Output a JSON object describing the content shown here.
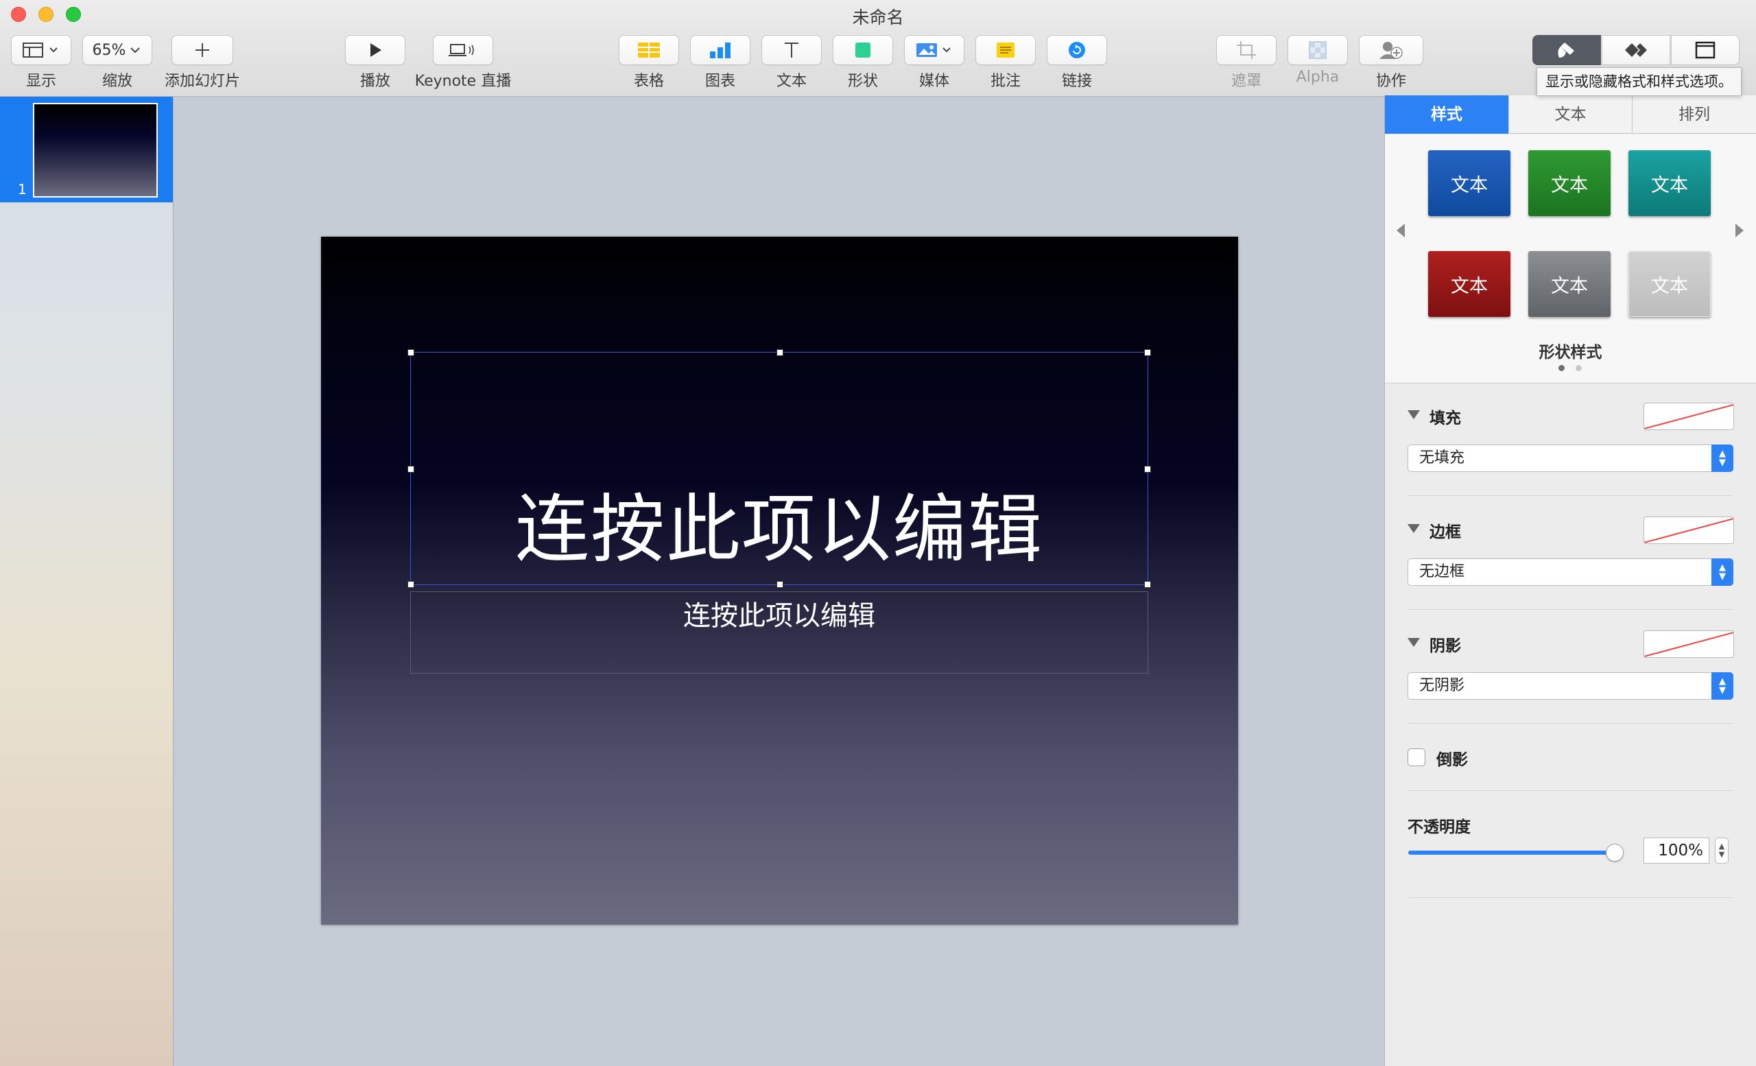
{
  "window": {
    "title": "未命名"
  },
  "toolbar": {
    "view_label": "显示",
    "zoom_value": "65%",
    "zoom_label": "缩放",
    "add_slide_label": "添加幻灯片",
    "play_label": "播放",
    "keynote_live_label": "Keynote 直播",
    "table_label": "表格",
    "chart_label": "图表",
    "text_label": "文本",
    "shape_label": "形状",
    "media_label": "媒体",
    "comment_label": "批注",
    "link_label": "链接",
    "mask_label": "遮罩",
    "alpha_label": "Alpha",
    "collaborate_label": "协作",
    "tooltip": "显示或隐藏格式和样式选项。"
  },
  "navigator": {
    "slides": [
      {
        "number": "1"
      }
    ]
  },
  "slide": {
    "title": "连按此项以编辑",
    "subtitle": "连按此项以编辑"
  },
  "inspector": {
    "tabs": [
      "样式",
      "文本",
      "排列"
    ],
    "active_tab": "样式",
    "swatch_label": "文本",
    "swatches": [
      {
        "label": "文本",
        "color": "#1a5bb5"
      },
      {
        "label": "文本",
        "color": "#258a2a"
      },
      {
        "label": "文本",
        "color": "#16918f"
      },
      {
        "label": "文本",
        "color": "#9e1a1a"
      },
      {
        "label": "文本",
        "color": "#7a7d80"
      },
      {
        "label": "文本",
        "color": "#c9c9c9"
      }
    ],
    "styles_title": "形状样式",
    "fill": {
      "label": "填充",
      "value": "无填充"
    },
    "border": {
      "label": "边框",
      "value": "无边框"
    },
    "shadow": {
      "label": "阴影",
      "value": "无阴影"
    },
    "reflection": {
      "label": "倒影",
      "checked": false
    },
    "opacity": {
      "label": "不透明度",
      "value": "100%",
      "level": 1.0
    }
  },
  "colors": {
    "accent": "#2c82f5",
    "selection": "#1b7cf2"
  }
}
